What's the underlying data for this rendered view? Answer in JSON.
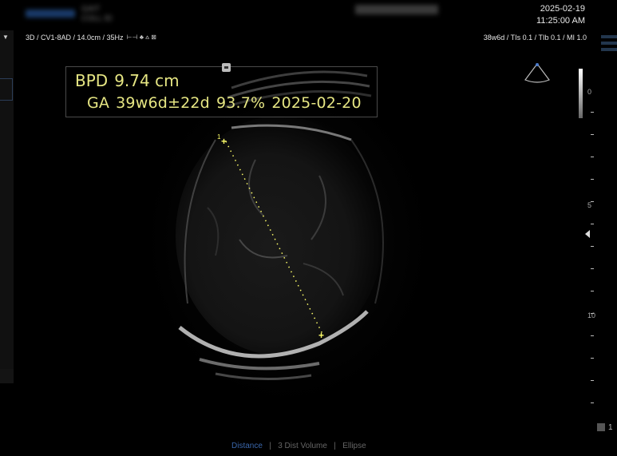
{
  "header": {
    "patient_name": "GAIT",
    "patient_id": "COLL ID",
    "date": "2025-02-19",
    "time": "11:25:00 AM"
  },
  "status": {
    "probe_info": "3D / CV1-8AD / 14.0cm / 35Hz",
    "indices": "38w6d / TIs  0.1 / TIb  0.1 / MI   1.0"
  },
  "measurement": {
    "bpd_label": "BPD",
    "bpd_value": "9.74 cm",
    "ga_label": "GA",
    "ga_value": "39w6d±22d",
    "ga_percent": "93.7%",
    "ga_edd": "2025-02-20",
    "caliper_start_label": "1"
  },
  "depth_scale": {
    "labels": [
      "0",
      "5",
      "10"
    ]
  },
  "bottom_tabs": {
    "tab1": "Distance",
    "sep1": "|",
    "tab2": "3 Dist Volume",
    "sep2": "|",
    "tab3": "Ellipse"
  },
  "bottom_right": {
    "value": "1"
  },
  "colors": {
    "measurement_text": "#e6e683",
    "caliper": "#ffff6a",
    "background": "#000000"
  },
  "icons": [
    "dropdown-arrow-icon",
    "lock-icon",
    "probe-fan-icon",
    "focus-marker-icon",
    "caliper-cross-icon"
  ]
}
